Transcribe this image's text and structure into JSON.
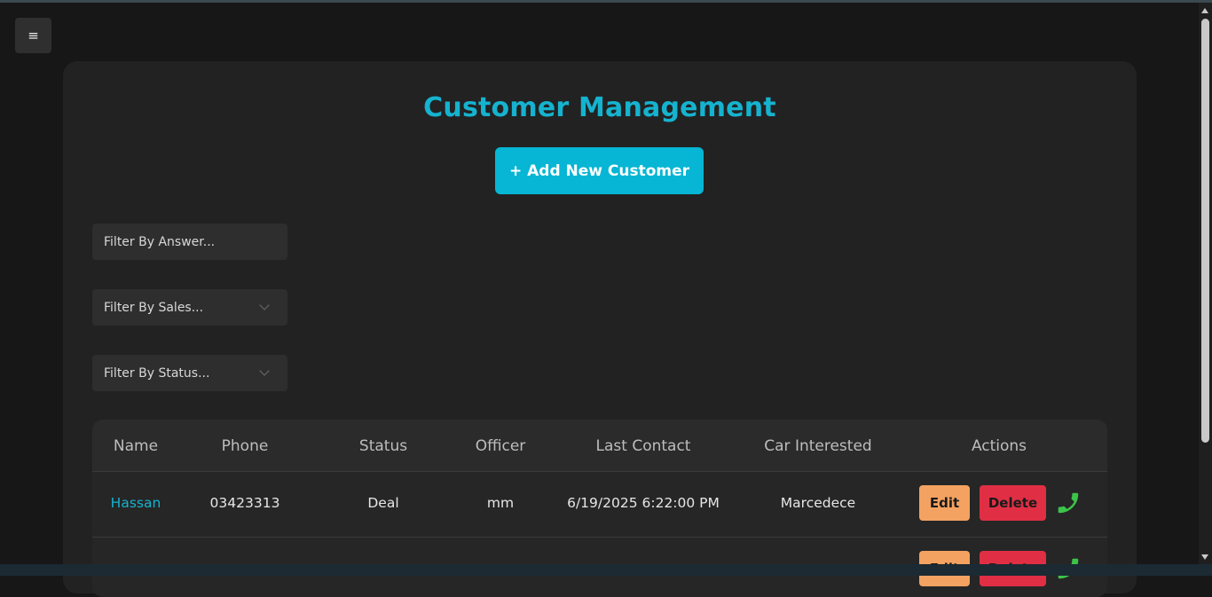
{
  "menu": {
    "icon": "hamburger-icon",
    "glyph": "≡"
  },
  "page": {
    "title": "Customer Management",
    "add_button_label": "+ Add New Customer",
    "accent_color": "#06b6d4"
  },
  "filters": {
    "answer_placeholder": "Filter By Answer...",
    "sales_placeholder": "Filter By Sales...",
    "status_placeholder": "Filter By Status..."
  },
  "table": {
    "headers": {
      "name": "Name",
      "phone": "Phone",
      "status": "Status",
      "officer": "Officer",
      "last_contact": "Last Contact",
      "car_interested": "Car Interested",
      "actions": "Actions"
    },
    "rows": [
      {
        "name": "Hassan",
        "phone": "03423313",
        "status": "Deal",
        "officer": "mm",
        "last_contact": "6/19/2025 6:22:00 PM",
        "car_interested": "Marcedece",
        "edit_label": "Edit",
        "delete_label": "Delete",
        "call_icon": "phone-icon"
      },
      {
        "edit_label": "Edit",
        "delete_label": "Delete",
        "call_icon": "phone-icon"
      }
    ]
  }
}
